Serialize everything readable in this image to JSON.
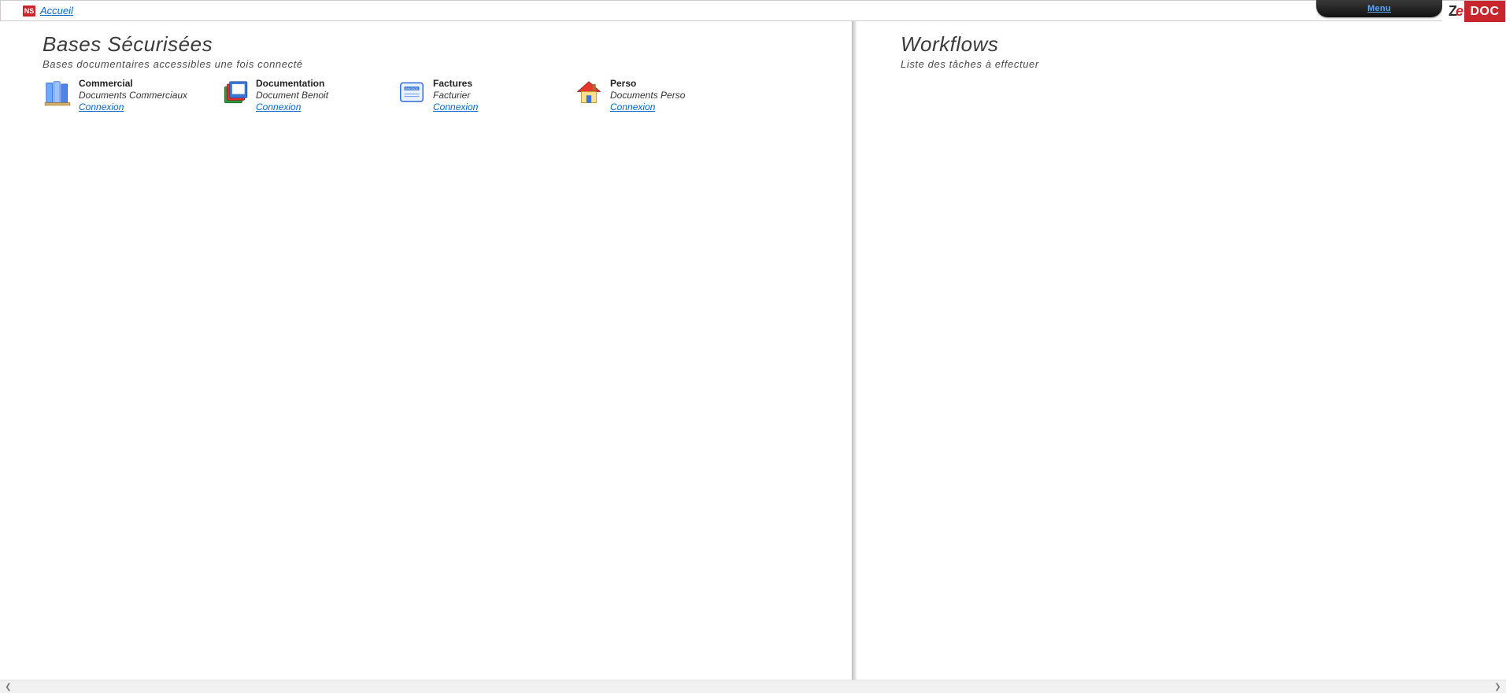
{
  "topbar": {
    "ns_badge": "NS",
    "accueil_label": "Accueil",
    "menu_label": "Menu"
  },
  "logo": {
    "left_z": "Z",
    "left_e": "e",
    "right": "DOC"
  },
  "left_section": {
    "title": "Bases Sécurisées",
    "subtitle": "Bases documentaires accessibles une fois connecté"
  },
  "right_section": {
    "title": "Workflows",
    "subtitle": "Liste des tâches à effectuer"
  },
  "link_label": "Connexion",
  "bases": [
    {
      "title": "Commercial",
      "desc": "Documents Commerciaux",
      "icon": "books-blue"
    },
    {
      "title": "Documentation",
      "desc": "Document Benoit",
      "icon": "books-rgb"
    },
    {
      "title": "Factures",
      "desc": "Facturier",
      "icon": "invoice"
    },
    {
      "title": "Perso",
      "desc": "Documents Perso",
      "icon": "house"
    }
  ]
}
